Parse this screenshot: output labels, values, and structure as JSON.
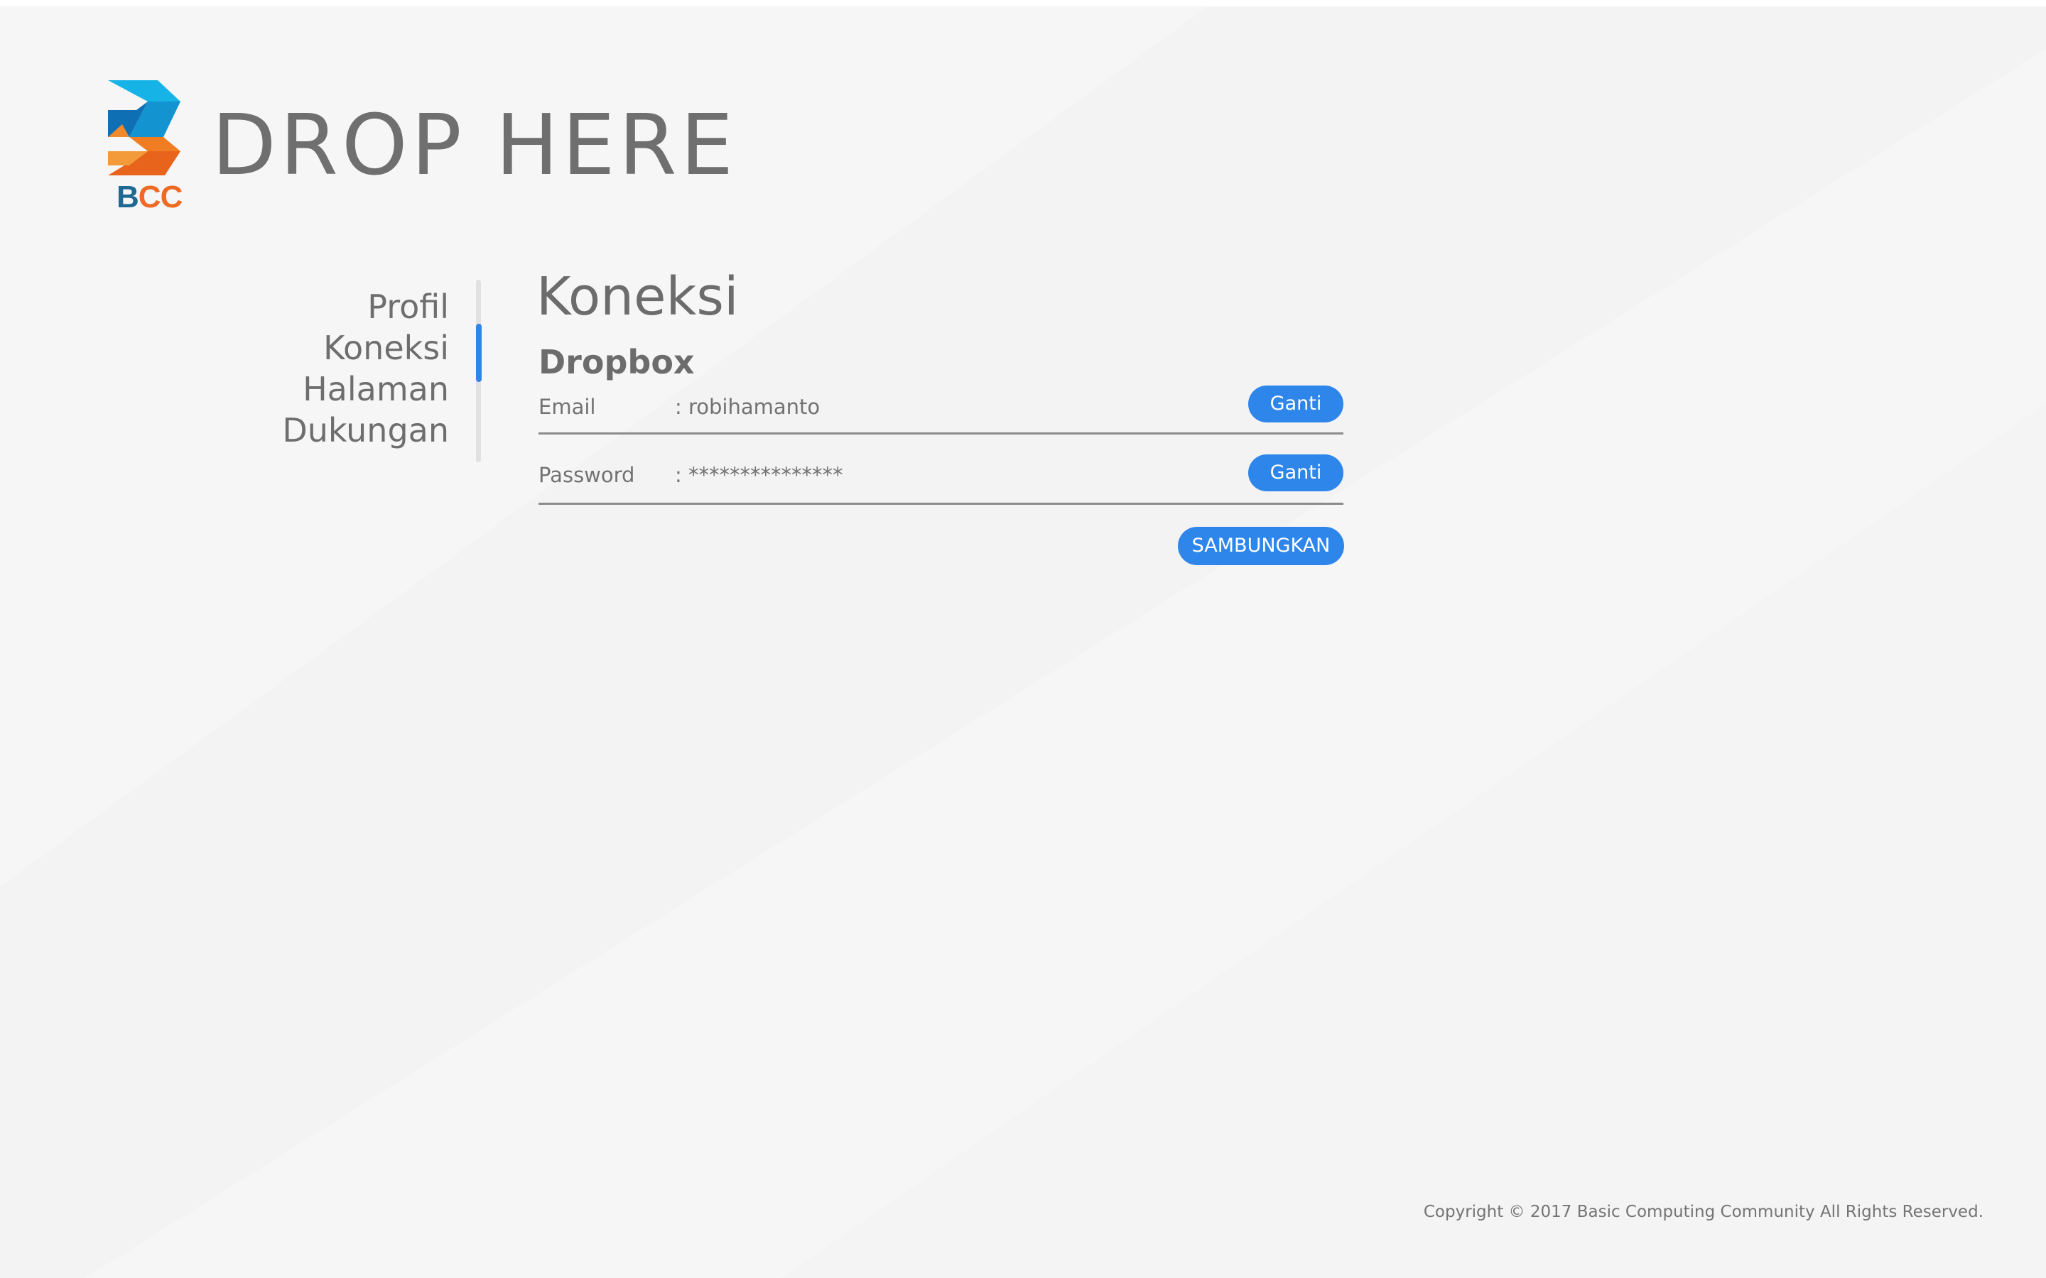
{
  "header": {
    "logo": {
      "letters": [
        "B",
        "C",
        "C"
      ],
      "colors": {
        "blue": "#1aa7dd",
        "dark_blue": "#1f6a93",
        "orange": "#ef6a22"
      }
    },
    "app_title": "DROP HERE"
  },
  "sidebar": {
    "items": [
      {
        "label": "Profil",
        "active": false
      },
      {
        "label": "Koneksi",
        "active": true
      },
      {
        "label": "Halaman",
        "active": false
      },
      {
        "label": "Dukungan",
        "active": false
      }
    ],
    "indicator_color": "#2f86ea"
  },
  "main": {
    "section_title": "Koneksi",
    "service_title": "Dropbox",
    "fields": {
      "email": {
        "label": "Email",
        "value": ": robihamanto",
        "button": "Ganti"
      },
      "password": {
        "label": "Password",
        "value": ": ***************",
        "button": "Ganti"
      }
    },
    "connect_button": "SAMBUNGKAN"
  },
  "footer": {
    "copyright": "Copyright © 2017 Basic Computing Community All Rights Reserved."
  },
  "colors": {
    "accent": "#2f86ea",
    "background": "#f6f6f6",
    "text": "#6f6f6f"
  }
}
